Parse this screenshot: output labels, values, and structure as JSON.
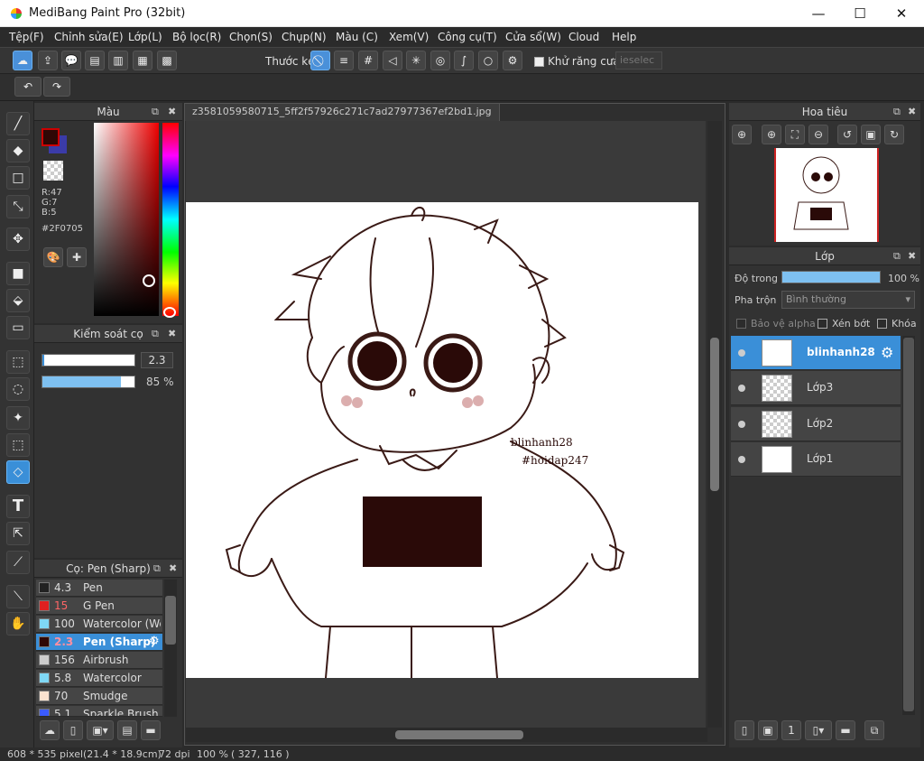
{
  "window": {
    "title": "MediBang Paint Pro (32bit)",
    "minimize": "—",
    "maximize": "☐",
    "close": "✕"
  },
  "menu": [
    "Tệp(F)",
    "Chỉnh sửa(E)",
    "Lớp(L)",
    "Bộ lọc(R)",
    "Chọn(S)",
    "Chụp(N)",
    "Màu (C)",
    "Xem(V)",
    "Công cụ(T)",
    "Cửa sổ(W)",
    "Cloud",
    "Help"
  ],
  "toolbar": {
    "ruler_label": "Thước kẻ",
    "antialias_label": "Khử răng cưa",
    "select_placeholder": "ieselec"
  },
  "color_panel": {
    "title": "Màu",
    "r": "R:47",
    "g": "G:7",
    "b": "B:5",
    "hex": "#2F0705",
    "foreground_color": "#2F0705",
    "background_color": "#3B3BA8"
  },
  "brush_control": {
    "title": "Kiểm soát cọ",
    "size_value": "2.3",
    "opacity_value": "85 %",
    "opacity_level": 0.85
  },
  "brush_panel": {
    "title": "Cọ: Pen (Sharp)",
    "brushes": [
      {
        "size": "4.3",
        "name": "Pen",
        "color": "#222222"
      },
      {
        "size": "15",
        "name": "G Pen",
        "color": "#e02020"
      },
      {
        "size": "100",
        "name": "Watercolor (We",
        "color": "#7fd8f5"
      },
      {
        "size": "2.3",
        "name": "Pen (Sharp)",
        "color": "#2f0705"
      },
      {
        "size": "156",
        "name": "Airbrush",
        "color": "#cccccc"
      },
      {
        "size": "5.8",
        "name": "Watercolor",
        "color": "#7fd8f5"
      },
      {
        "size": "70",
        "name": "Smudge",
        "color": "#fbe3d0"
      },
      {
        "size": "5.1",
        "name": "Sparkle Brush",
        "color": "#3b5bff"
      }
    ]
  },
  "document": {
    "tab_name": "z3581059580715_5ff2f57926c271c7ad27977367ef2bd1.jpg",
    "signature_1": "blinhanh28",
    "signature_2": "#hoidap247"
  },
  "navigator": {
    "title": "Hoa tiêu"
  },
  "layer_panel": {
    "title": "Lớp",
    "opacity_label": "Độ trong",
    "opacity_value": "100 %",
    "opacity_level": 1.0,
    "blend_label": "Pha trộn",
    "blend_value": "Bình thường",
    "protect_alpha": "Bảo vệ alpha",
    "clipping": "Xén bớt",
    "lock": "Khóa",
    "layers": [
      {
        "name": "blinhanh28"
      },
      {
        "name": "Lớp3"
      },
      {
        "name": "Lớp2"
      },
      {
        "name": "Lớp1"
      }
    ]
  },
  "status": {
    "pixels": "608 * 535 pixel",
    "size_cm": "(21.4 * 18.9cm)",
    "dpi": "72 dpi",
    "zoom": "100 %",
    "cursor": "( 327, 116 )"
  }
}
